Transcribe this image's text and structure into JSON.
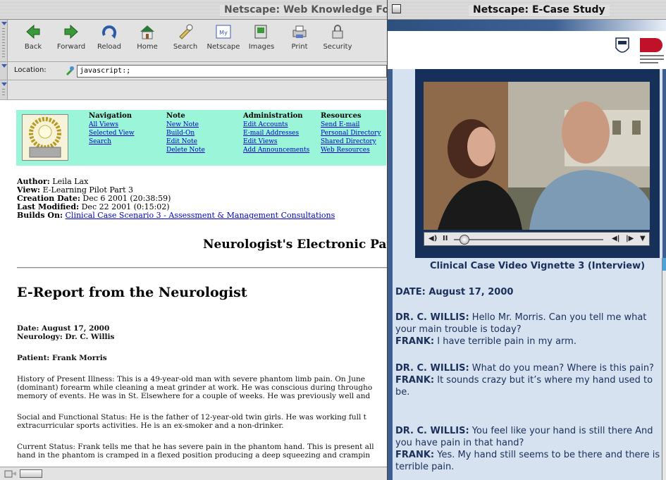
{
  "window_main": {
    "title": "Netscape: Web Knowledge For",
    "toolbar": {
      "buttons": [
        {
          "label": "Back",
          "icon": "back-arrow-icon"
        },
        {
          "label": "Forward",
          "icon": "forward-arrow-icon"
        },
        {
          "label": "Reload",
          "icon": "reload-icon"
        },
        {
          "label": "Home",
          "icon": "home-icon"
        },
        {
          "label": "Search",
          "icon": "search-icon"
        },
        {
          "label": "Netscape",
          "icon": "netscape-icon"
        },
        {
          "label": "Images",
          "icon": "images-icon"
        },
        {
          "label": "Print",
          "icon": "print-icon"
        },
        {
          "label": "Security",
          "icon": "lock-icon"
        }
      ]
    },
    "location": {
      "label": "Location:",
      "value": "javascript:;"
    },
    "nav": {
      "columns": [
        {
          "head": "Navigation",
          "links": [
            "All Views",
            "Selected View",
            "Search"
          ]
        },
        {
          "head": "Note",
          "links": [
            "New Note",
            "Build-On",
            "Edit Note",
            "Delete Note"
          ]
        },
        {
          "head": "Administration",
          "links": [
            "Edit Accounts",
            "E-mail Addresses",
            "Edit Views",
            "Add Announcements"
          ]
        },
        {
          "head": "Resources",
          "links": [
            "Send E-mail",
            "Personal Directory",
            "Shared Directory",
            "Web Resources"
          ]
        }
      ]
    },
    "meta": {
      "author_label": "Author:",
      "author": "Leila Lax",
      "view_label": "View:",
      "view": "E-Learning Pilot Part 3",
      "created_label": "Creation Date:",
      "created": "Dec 6 2001 (20:38:59)",
      "modified_label": "Last Modified:",
      "modified": "Dec 22 2001 (0:15:02)",
      "builds_label": "Builds On:",
      "builds_on": "Clinical Case Scenario 3 - Assessment & Management Consultations"
    },
    "page_heading": "Neurologist's Electronic Pat",
    "report_title": "E-Report from the Neurologist",
    "date_line": "Date: August 17, 2000",
    "neurology_line": "Neurology: Dr. C. Willis",
    "patient_line": "Patient: Frank Morris",
    "hpi": [
      "History of Present Illness: This is a 49-year-old man with severe phantom limb pain. On June",
      "(dominant) forearm while cleaning a meat grinder at work. He was conscious during througho",
      "memory of events. He was in St. Elsewhere for a couple of weeks. He was previously well and"
    ],
    "social": [
      "Social and Functional Status: He is the father of 12-year-old twin girls. He was working full t",
      "extracurricular sports activities. He is an ex-smoker and a non-drinker."
    ],
    "current": [
      "Current Status: Frank tells me that he has severe pain in the phantom hand. This is present all",
      "hand in the phantom is cramped in a flexed position producing a deep squeezing and crampin"
    ]
  },
  "window_case": {
    "title": "Netscape: E-Case Study",
    "video_caption": "Clinical Case Video Vignette 3 (Interview)",
    "controls": {
      "volume": "◀)",
      "pause": "II",
      "rewind": "◀|",
      "forward": "|▶",
      "menu": "▼"
    },
    "date": "DATE: August 17, 2000",
    "dialogue": [
      {
        "speaker": "DR. C. WILLIS:",
        "text": " Hello Mr. Morris. Can you tell me what your main trouble is today?"
      },
      {
        "speaker": "FRANK:",
        "text": " I have terrible pain in my arm."
      },
      {
        "speaker": "DR. C. WILLIS:",
        "text": " What do you mean? Where is this pain?"
      },
      {
        "speaker": "FRANK:",
        "text": " It sounds crazy but it’s where my hand used to be."
      },
      {
        "speaker": "DR. C. WILLIS:",
        "text": " You feel like your hand is still there And you have pain in that hand?"
      },
      {
        "speaker": "FRANK:",
        "text": " Yes. My hand still seems to be there and there is terrible pain."
      }
    ]
  }
}
